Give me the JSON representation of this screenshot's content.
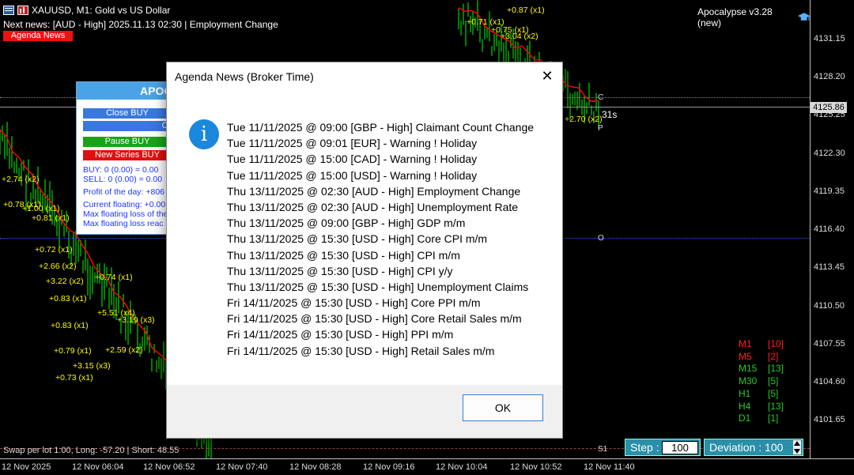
{
  "chart": {
    "symbol_title": "XAUUSD, M1:  Gold vs US Dollar",
    "next_news": "Next news: [AUD - High] 2025.11.13 02:30 | Employment Change",
    "agenda_button": "Agenda News",
    "ea_title": "Apocalypse v3.28 (new)",
    "current_price": "4125.86",
    "countdown": "31s",
    "y_ticks": [
      "4131.15",
      "4128.20",
      "4125.25",
      "4122.30",
      "4119.35",
      "4116.40",
      "4113.45",
      "4110.50",
      "4107.55",
      "4104.60",
      "4101.65"
    ],
    "x_ticks": [
      "12 Nov 2025",
      "12 Nov 06:04",
      "12 Nov 06:52",
      "12 Nov 07:40",
      "12 Nov 08:28",
      "12 Nov 09:16",
      "12 Nov 10:04",
      "12 Nov 10:52",
      "12 Nov 11:40"
    ],
    "line_markers": {
      "c": "C",
      "p": "P",
      "o": "O",
      "s1": "S1"
    },
    "swap_text": "Swap per lot 1:00, Long: -57.20 | Short: 48.55",
    "chart_labels": [
      "+0.87 (x1)",
      "+0.71 (x1)",
      "+0.75 (x1)",
      "+3.04 (x2)",
      "+0.78 (x1)",
      "+0.81 (x1)",
      "+0.72 (x1)",
      "+2.66 (x2)",
      "+3.22 (x2)",
      "+0.74 (x1)",
      "+0.83 (x1)",
      "+0.83 (x1)",
      "+5.51 (x4)",
      "+3.19 (x3)",
      "+0.79 (x1)",
      "+2.59 (x2)",
      "+3.15 (x3)",
      "+0.73 (x1)",
      "+2.70 (x2)",
      "+1.00 (x1)",
      "+2.74 (x2)"
    ]
  },
  "ea_panel": {
    "title": "APOC",
    "close_buy": "Close BUY",
    "close_all": "Cl",
    "pause_buy": "Pause BUY",
    "new_series_buy": "New Series BUY",
    "buy_info": "BUY: 0 (0.00) = 0.00",
    "sell_info": "SELL: 0 (0.00) = 0.00",
    "profit_day": "Profit of the day: +806",
    "current_floating": "Current floating: +0.00",
    "max_floating": "Max floating loss of the",
    "max_floating_reached": "Max floating loss reac"
  },
  "timeframes": [
    {
      "tf": "M1",
      "count": "[10]",
      "color": "#ff2020"
    },
    {
      "tf": "M5",
      "count": "[2]",
      "color": "#ff2020"
    },
    {
      "tf": "M15",
      "count": "[13]",
      "color": "#22cc22"
    },
    {
      "tf": "M30",
      "count": "[5]",
      "color": "#22cc22"
    },
    {
      "tf": "H1",
      "count": "[5]",
      "color": "#22cc22"
    },
    {
      "tf": "H4",
      "count": "[13]",
      "color": "#22cc22"
    },
    {
      "tf": "D1",
      "count": "[1]",
      "color": "#22cc22"
    }
  ],
  "controls": {
    "step_label": "Step :",
    "step_value": "100",
    "deviation_label": "Deviation : 100"
  },
  "dialog": {
    "title": "Agenda News (Broker Time)",
    "close_glyph": "✕",
    "info_glyph": "i",
    "ok_label": "OK",
    "items": [
      "Tue 11/11/2025 @ 09:00 [GBP - High] Claimant Count Change",
      "Tue 11/11/2025 @ 09:01 [EUR] - Warning ! Holiday",
      "Tue 11/11/2025 @ 15:00 [CAD] - Warning ! Holiday",
      "Tue 11/11/2025 @ 15:00 [USD] - Warning ! Holiday",
      "Thu 13/11/2025 @ 02:30 [AUD - High] Employment Change",
      "Thu 13/11/2025 @ 02:30 [AUD - High] Unemployment Rate",
      "Thu 13/11/2025 @ 09:00 [GBP - High] GDP m/m",
      "Thu 13/11/2025 @ 15:30 [USD - High] Core CPI m/m",
      "Thu 13/11/2025 @ 15:30 [USD - High] CPI m/m",
      "Thu 13/11/2025 @ 15:30 [USD - High] CPI y/y",
      "Thu 13/11/2025 @ 15:30 [USD - High] Unemployment Claims",
      "Fri 14/11/2025 @ 15:30 [USD - High] Core PPI m/m",
      "Fri 14/11/2025 @ 15:30 [USD - High] Core Retail Sales m/m",
      "Fri 14/11/2025 @ 15:30 [USD - High] PPI m/m",
      "Fri 14/11/2025 @ 15:30 [USD - High] Retail Sales m/m"
    ]
  },
  "colors": {
    "chart_bg": "#000000",
    "bull_candle": "#00ff00",
    "trend_line": "#ff0000",
    "label_text": "#ffff00",
    "panel_header": "#4aa3e6",
    "info_icon": "#1b87dd",
    "ok_border": "#3a7bd5"
  }
}
